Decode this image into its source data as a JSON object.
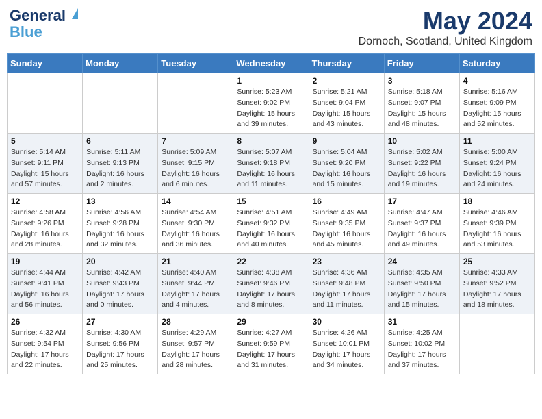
{
  "header": {
    "logo_line1": "General",
    "logo_line2": "Blue",
    "title": "May 2024",
    "subtitle": "Dornoch, Scotland, United Kingdom"
  },
  "weekdays": [
    "Sunday",
    "Monday",
    "Tuesday",
    "Wednesday",
    "Thursday",
    "Friday",
    "Saturday"
  ],
  "weeks": [
    [
      {
        "day": "",
        "info": ""
      },
      {
        "day": "",
        "info": ""
      },
      {
        "day": "",
        "info": ""
      },
      {
        "day": "1",
        "info": "Sunrise: 5:23 AM\nSunset: 9:02 PM\nDaylight: 15 hours\nand 39 minutes."
      },
      {
        "day": "2",
        "info": "Sunrise: 5:21 AM\nSunset: 9:04 PM\nDaylight: 15 hours\nand 43 minutes."
      },
      {
        "day": "3",
        "info": "Sunrise: 5:18 AM\nSunset: 9:07 PM\nDaylight: 15 hours\nand 48 minutes."
      },
      {
        "day": "4",
        "info": "Sunrise: 5:16 AM\nSunset: 9:09 PM\nDaylight: 15 hours\nand 52 minutes."
      }
    ],
    [
      {
        "day": "5",
        "info": "Sunrise: 5:14 AM\nSunset: 9:11 PM\nDaylight: 15 hours\nand 57 minutes."
      },
      {
        "day": "6",
        "info": "Sunrise: 5:11 AM\nSunset: 9:13 PM\nDaylight: 16 hours\nand 2 minutes."
      },
      {
        "day": "7",
        "info": "Sunrise: 5:09 AM\nSunset: 9:15 PM\nDaylight: 16 hours\nand 6 minutes."
      },
      {
        "day": "8",
        "info": "Sunrise: 5:07 AM\nSunset: 9:18 PM\nDaylight: 16 hours\nand 11 minutes."
      },
      {
        "day": "9",
        "info": "Sunrise: 5:04 AM\nSunset: 9:20 PM\nDaylight: 16 hours\nand 15 minutes."
      },
      {
        "day": "10",
        "info": "Sunrise: 5:02 AM\nSunset: 9:22 PM\nDaylight: 16 hours\nand 19 minutes."
      },
      {
        "day": "11",
        "info": "Sunrise: 5:00 AM\nSunset: 9:24 PM\nDaylight: 16 hours\nand 24 minutes."
      }
    ],
    [
      {
        "day": "12",
        "info": "Sunrise: 4:58 AM\nSunset: 9:26 PM\nDaylight: 16 hours\nand 28 minutes."
      },
      {
        "day": "13",
        "info": "Sunrise: 4:56 AM\nSunset: 9:28 PM\nDaylight: 16 hours\nand 32 minutes."
      },
      {
        "day": "14",
        "info": "Sunrise: 4:54 AM\nSunset: 9:30 PM\nDaylight: 16 hours\nand 36 minutes."
      },
      {
        "day": "15",
        "info": "Sunrise: 4:51 AM\nSunset: 9:32 PM\nDaylight: 16 hours\nand 40 minutes."
      },
      {
        "day": "16",
        "info": "Sunrise: 4:49 AM\nSunset: 9:35 PM\nDaylight: 16 hours\nand 45 minutes."
      },
      {
        "day": "17",
        "info": "Sunrise: 4:47 AM\nSunset: 9:37 PM\nDaylight: 16 hours\nand 49 minutes."
      },
      {
        "day": "18",
        "info": "Sunrise: 4:46 AM\nSunset: 9:39 PM\nDaylight: 16 hours\nand 53 minutes."
      }
    ],
    [
      {
        "day": "19",
        "info": "Sunrise: 4:44 AM\nSunset: 9:41 PM\nDaylight: 16 hours\nand 56 minutes."
      },
      {
        "day": "20",
        "info": "Sunrise: 4:42 AM\nSunset: 9:43 PM\nDaylight: 17 hours\nand 0 minutes."
      },
      {
        "day": "21",
        "info": "Sunrise: 4:40 AM\nSunset: 9:44 PM\nDaylight: 17 hours\nand 4 minutes."
      },
      {
        "day": "22",
        "info": "Sunrise: 4:38 AM\nSunset: 9:46 PM\nDaylight: 17 hours\nand 8 minutes."
      },
      {
        "day": "23",
        "info": "Sunrise: 4:36 AM\nSunset: 9:48 PM\nDaylight: 17 hours\nand 11 minutes."
      },
      {
        "day": "24",
        "info": "Sunrise: 4:35 AM\nSunset: 9:50 PM\nDaylight: 17 hours\nand 15 minutes."
      },
      {
        "day": "25",
        "info": "Sunrise: 4:33 AM\nSunset: 9:52 PM\nDaylight: 17 hours\nand 18 minutes."
      }
    ],
    [
      {
        "day": "26",
        "info": "Sunrise: 4:32 AM\nSunset: 9:54 PM\nDaylight: 17 hours\nand 22 minutes."
      },
      {
        "day": "27",
        "info": "Sunrise: 4:30 AM\nSunset: 9:56 PM\nDaylight: 17 hours\nand 25 minutes."
      },
      {
        "day": "28",
        "info": "Sunrise: 4:29 AM\nSunset: 9:57 PM\nDaylight: 17 hours\nand 28 minutes."
      },
      {
        "day": "29",
        "info": "Sunrise: 4:27 AM\nSunset: 9:59 PM\nDaylight: 17 hours\nand 31 minutes."
      },
      {
        "day": "30",
        "info": "Sunrise: 4:26 AM\nSunset: 10:01 PM\nDaylight: 17 hours\nand 34 minutes."
      },
      {
        "day": "31",
        "info": "Sunrise: 4:25 AM\nSunset: 10:02 PM\nDaylight: 17 hours\nand 37 minutes."
      },
      {
        "day": "",
        "info": ""
      }
    ]
  ]
}
